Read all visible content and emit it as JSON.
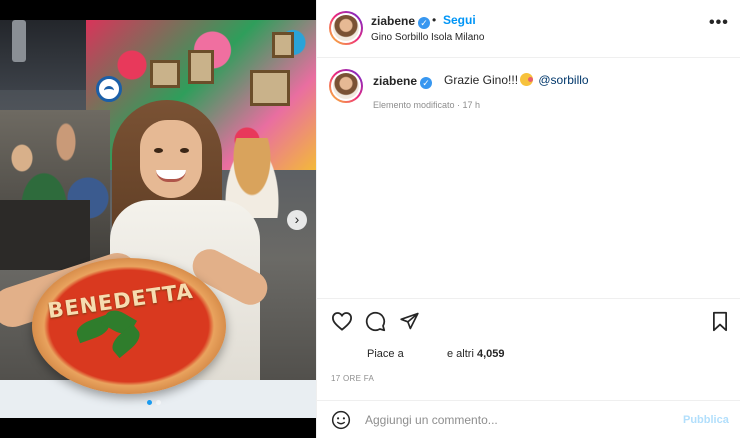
{
  "post": {
    "username": "ziabene",
    "verified": true,
    "follow_label": "Segui",
    "separator": "•",
    "location": "Gino Sorbillo Isola Milano",
    "more_icon": "more-horizontal-icon",
    "pizza_text": "BENEDETTA"
  },
  "caption": {
    "username": "ziabene",
    "text": "Grazie Gino!!!",
    "mention": "@sorbillo",
    "edited_label": "Elemento modificato",
    "time": "17 h"
  },
  "actions": {
    "like_icon": "heart-icon",
    "comment_icon": "comment-icon",
    "share_icon": "send-icon",
    "save_icon": "bookmark-icon"
  },
  "likes": {
    "prefix": "Piace a",
    "rest": "e altri",
    "count": "4,059"
  },
  "timestamp": "17 ORE FA",
  "comment": {
    "placeholder": "Aggiungi un commento...",
    "publish_label": "Pubblica",
    "emoji_icon": "emoji-icon"
  },
  "colors": {
    "accent": "#0095f6",
    "verified": "#3897f0",
    "muted": "#8e8e8e",
    "publish_disabled": "#b2dffc"
  }
}
